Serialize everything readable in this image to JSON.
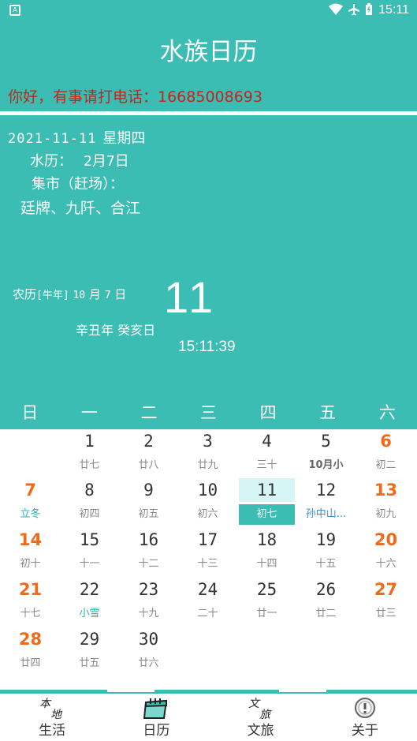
{
  "status_bar": {
    "app_icon": "A",
    "icons": [
      "wifi-icon",
      "airplane-icon",
      "battery-icon"
    ],
    "time": "15:11"
  },
  "header": {
    "title": "水族日历",
    "notice": "你好，有事请打电话：16685008693"
  },
  "info": {
    "date": "2021-11-11",
    "weekday": "星期四",
    "water_label": "水历：",
    "water_value": "2月7日",
    "market_label": "集市（赶场）：",
    "market_places": "廷牌、九阡、合江",
    "lunar_prefix": "农历",
    "lunar_year_tag": "[牛年]",
    "lunar_month": "10",
    "lunar_month_unit": "月",
    "lunar_day": "7",
    "lunar_day_unit": "日",
    "big_day": "11",
    "ganzhi": "辛丑年 癸亥日",
    "clock": "15:11:39"
  },
  "calendar": {
    "weekdays": [
      "日",
      "一",
      "二",
      "三",
      "四",
      "五",
      "六"
    ],
    "weeks": [
      [
        null,
        {
          "d": "1",
          "l": "廿七"
        },
        {
          "d": "2",
          "l": "廿八"
        },
        {
          "d": "3",
          "l": "廿九"
        },
        {
          "d": "4",
          "l": "三十"
        },
        {
          "d": "5",
          "l": "10月小"
        },
        {
          "d": "6",
          "l": "初二"
        }
      ],
      [
        {
          "d": "7",
          "l": "立冬"
        },
        {
          "d": "8",
          "l": "初四"
        },
        {
          "d": "9",
          "l": "初五"
        },
        {
          "d": "10",
          "l": "初六"
        },
        {
          "d": "11",
          "l": "初七"
        },
        {
          "d": "12",
          "l": "孙中山..."
        },
        {
          "d": "13",
          "l": "初九"
        }
      ],
      [
        {
          "d": "14",
          "l": "初十"
        },
        {
          "d": "15",
          "l": "十一"
        },
        {
          "d": "16",
          "l": "十二"
        },
        {
          "d": "17",
          "l": "十三"
        },
        {
          "d": "18",
          "l": "十四"
        },
        {
          "d": "19",
          "l": "十五"
        },
        {
          "d": "20",
          "l": "十六"
        }
      ],
      [
        {
          "d": "21",
          "l": "十七"
        },
        {
          "d": "22",
          "l": "小雪"
        },
        {
          "d": "23",
          "l": "十九"
        },
        {
          "d": "24",
          "l": "二十"
        },
        {
          "d": "25",
          "l": "廿一"
        },
        {
          "d": "26",
          "l": "廿二"
        },
        {
          "d": "27",
          "l": "廿三"
        }
      ],
      [
        {
          "d": "28",
          "l": "廿四"
        },
        {
          "d": "29",
          "l": "廿五"
        },
        {
          "d": "30",
          "l": "廿六"
        },
        null,
        null,
        null,
        null
      ]
    ],
    "selected_day": "11",
    "term_days": [
      "7",
      "22"
    ],
    "festival_days": [
      "12"
    ],
    "month_start_days": [
      "5"
    ]
  },
  "bottom_nav": [
    {
      "label": "生活",
      "icon": "life-icon",
      "icon_text": "本地"
    },
    {
      "label": "日历",
      "icon": "calendar-icon",
      "icon_text": ""
    },
    {
      "label": "文旅",
      "icon": "culture-travel-icon",
      "icon_text": "文旅"
    },
    {
      "label": "关于",
      "icon": "info-icon",
      "icon_text": "!"
    }
  ],
  "colors": {
    "primary": "#3bbdb3",
    "notice": "#c0251e",
    "weekend": "#f06a1a",
    "solar_term": "#22b3b3",
    "festival": "#3d8fd6"
  }
}
